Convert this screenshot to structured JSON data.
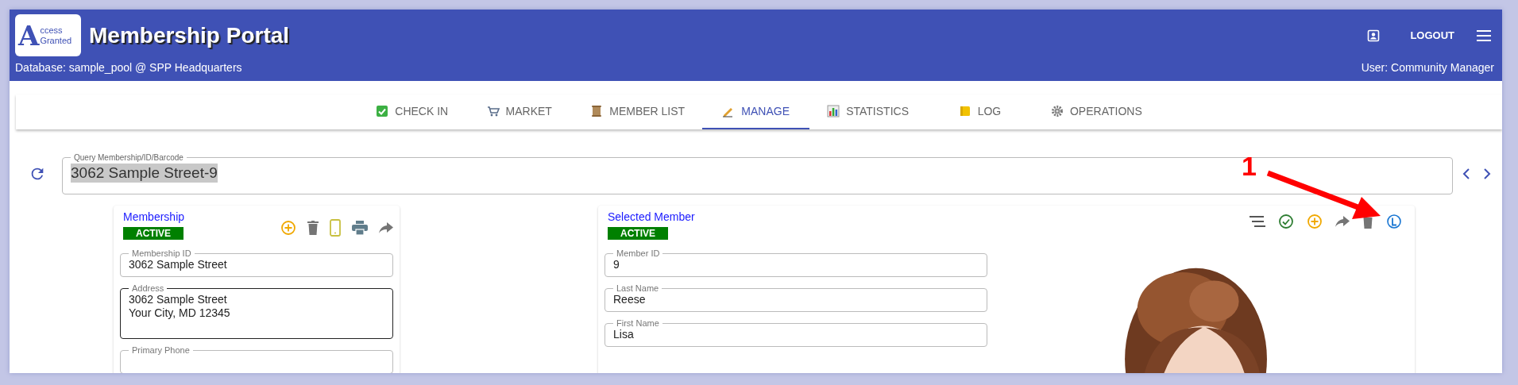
{
  "header": {
    "logo": {
      "letter": "A",
      "words": [
        "ccess",
        "Granted"
      ]
    },
    "title": "Membership Portal",
    "database": "Database: sample_pool @ SPP Headquarters",
    "logout": "LOGOUT",
    "user": "User: Community Manager"
  },
  "tabs": [
    {
      "label": "CHECK IN",
      "kind": "check",
      "selected": false
    },
    {
      "label": "MARKET",
      "kind": "cart",
      "selected": false
    },
    {
      "label": "MEMBER LIST",
      "kind": "scroll",
      "selected": false
    },
    {
      "label": "MANAGE",
      "kind": "pen",
      "selected": true
    },
    {
      "label": "STATISTICS",
      "kind": "chart",
      "selected": false
    },
    {
      "label": "LOG",
      "kind": "note",
      "selected": false
    },
    {
      "label": "OPERATIONS",
      "kind": "gear",
      "selected": false
    }
  ],
  "query": {
    "label": "Query Membership/ID/Barcode",
    "value": "3062 Sample Street-9",
    "highlighted": true
  },
  "membership": {
    "title": "Membership",
    "status": "ACTIVE",
    "fields": [
      {
        "label": "Membership ID",
        "value": "3062 Sample Street",
        "focused": false
      },
      {
        "label": "Address",
        "value": "3062 Sample Street\nYour City, MD 12345",
        "focused": true
      },
      {
        "label": "Primary Phone",
        "focused": false
      }
    ]
  },
  "member": {
    "title": "Selected Member",
    "status": "ACTIVE",
    "fields": [
      {
        "label": "Member ID",
        "value": "9",
        "focused": false
      },
      {
        "label": "Last Name",
        "value": "Reese",
        "focused": false
      },
      {
        "label": "First Name",
        "value": "Lisa",
        "focused": false
      }
    ]
  },
  "annotation": {
    "number": "1"
  }
}
